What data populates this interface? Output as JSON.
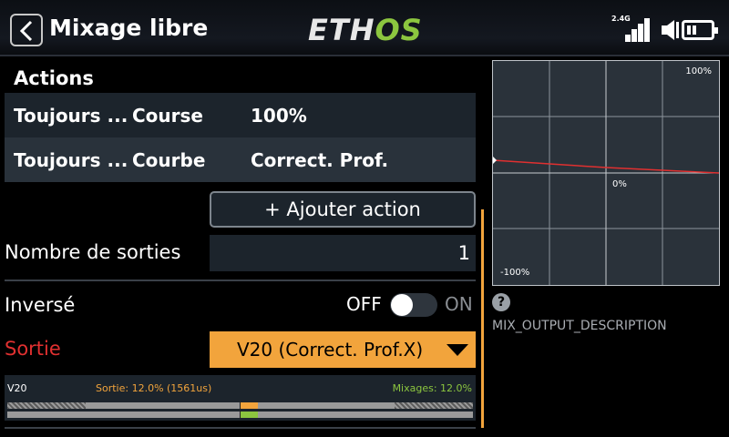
{
  "header": {
    "title": "Mixage libre",
    "logo_main": "ETH",
    "logo_accent": "OS",
    "radio_band": "2.4G"
  },
  "actions": {
    "title": "Actions",
    "rows": [
      {
        "condition": "Toujours ...",
        "type": "Course",
        "value": "100%"
      },
      {
        "condition": "Toujours ...",
        "type": "Courbe",
        "value": "Correct. Prof."
      }
    ],
    "add_label": "+ Ajouter action"
  },
  "outputs": {
    "label": "Nombre de sorties",
    "value": "1"
  },
  "inverse": {
    "label": "Inversé",
    "off_label": "OFF",
    "on_label": "ON",
    "state": "off"
  },
  "sortie": {
    "label": "Sortie",
    "value": "V20 (Correct. Prof.X)"
  },
  "monitor": {
    "channel": "V20",
    "output_text": "Sortie: 12.0% (1561us)",
    "mix_text": "Mixages: 12.0%",
    "output_percent": 12.0,
    "mix_percent": 12.0
  },
  "graph": {
    "top_label": "100%",
    "center_label": "0%",
    "bottom_label": "-100%"
  },
  "help": {
    "icon": "?",
    "description": "MIX_OUTPUT_DESCRIPTION"
  },
  "colors": {
    "accent_orange": "#f2a43c",
    "accent_green": "#8cc63f",
    "sortie_red": "#e03030"
  }
}
